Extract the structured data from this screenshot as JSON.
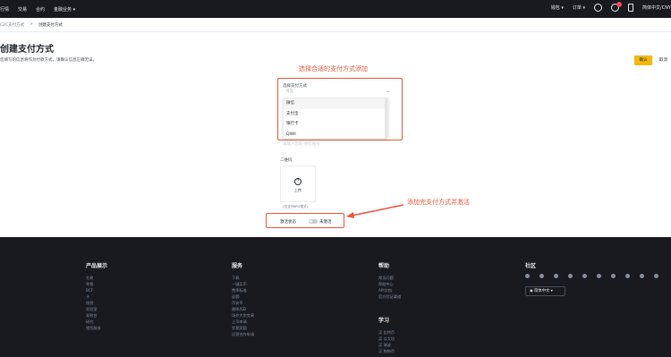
{
  "nav": {
    "left": [
      "行情",
      "交易",
      "合约",
      "金融业务 ▾"
    ],
    "right": [
      "钱包 ▾",
      "订单 ▾"
    ],
    "notification_count": "",
    "lang": "简体中文/CNY"
  },
  "breadcrumb": {
    "parent": "C2C支付方式",
    "sep": ">",
    "current": "创建支付方式"
  },
  "page": {
    "title": "创建支付方式",
    "subtitle": "您填写的信息将作为付款方式，请确认信息正确无误。",
    "confirm": "确认",
    "cancel": "取消"
  },
  "annotations": {
    "top": "选择合适的支付方式添加",
    "bottom": "添加完支付方式并激活"
  },
  "form": {
    "method_label": "选择支付方式",
    "method_placeholder": "请选",
    "options": [
      "微信",
      "支付宝",
      "银行卡",
      "QIWI"
    ],
    "ghost_text": "请输入您的·微信账号",
    "qr_label": "二维码",
    "upload_text": "上传",
    "upload_hint": "(仅支持JPG格式)",
    "status_label": "激活状态",
    "status_value": "未激活"
  },
  "footer": {
    "cols": [
      {
        "title": "产品展示",
        "items": [
          "交易",
          "举报",
          "BCF",
          "卡",
          "借贷",
          "实验室",
          "发射台",
          "研究",
          "猎托服务"
        ]
      },
      {
        "title": "服务",
        "items": [
          "下载",
          "一键买币",
          "费率标准",
          "返佣",
          "币安币",
          "邀BUSD",
          "场外大宗交易",
          "上币申请",
          "交易奖励",
          "运营合作申请"
        ]
      },
      {
        "title": "帮助",
        "items": [
          "常见问题",
          "帮助中心",
          "API文档",
          "官方验证渠道"
        ]
      },
      {
        "title": "学习",
        "items": [
          "买 比特币",
          "买 以太坊",
          "买 瑞波",
          "买 狗狗币"
        ]
      }
    ],
    "community_title": "社区",
    "lang": "简体中文"
  },
  "colors": {
    "accent": "#f0b90b",
    "annotation": "#e8563a",
    "dark": "#181a20"
  }
}
